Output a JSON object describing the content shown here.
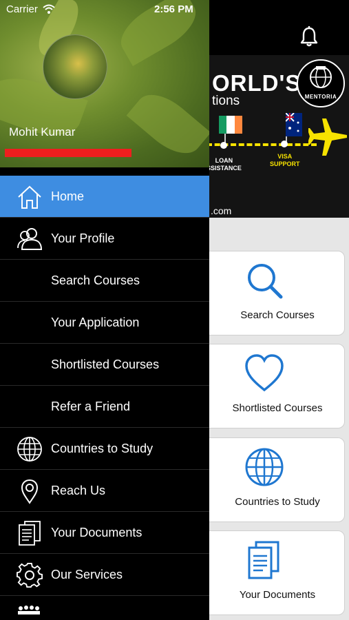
{
  "status_bar": {
    "carrier": "Carrier",
    "time": "2:56 PM"
  },
  "drawer": {
    "user_name": "Mohit Kumar",
    "menu": [
      {
        "label": "Home",
        "icon": "home-icon",
        "active": true
      },
      {
        "label": "Your Profile",
        "icon": "profile-icon"
      },
      {
        "label": "Search Courses",
        "icon": ""
      },
      {
        "label": "Your Application",
        "icon": ""
      },
      {
        "label": "Shortlisted Courses",
        "icon": ""
      },
      {
        "label": "Refer a Friend",
        "icon": ""
      },
      {
        "label": "Countries to Study",
        "icon": "globe-icon"
      },
      {
        "label": "Reach Us",
        "icon": "location-pin-icon"
      },
      {
        "label": "Your Documents",
        "icon": "document-icon"
      },
      {
        "label": "Our Services",
        "icon": "gear-icon"
      }
    ]
  },
  "banner": {
    "title": "ORLD'S",
    "subtitle": "tions",
    "logo_text": "MENTORIA",
    "loan_label": "LOAN\nSSISTANCE",
    "visa_label": "VISA\nSUPPORT",
    "url_fragment": ".com"
  },
  "tiles": [
    {
      "label": "Search Courses",
      "icon": "search-icon"
    },
    {
      "label": "Shortlisted Courses",
      "icon": "heart-icon"
    },
    {
      "label": "Countries to Study",
      "icon": "globe-icon"
    },
    {
      "label": "Your Documents",
      "icon": "document-icon"
    }
  ],
  "colors": {
    "active_item": "#3e8de1",
    "accent_icon": "#1f77d0",
    "redaction": "#ee1e1e"
  }
}
